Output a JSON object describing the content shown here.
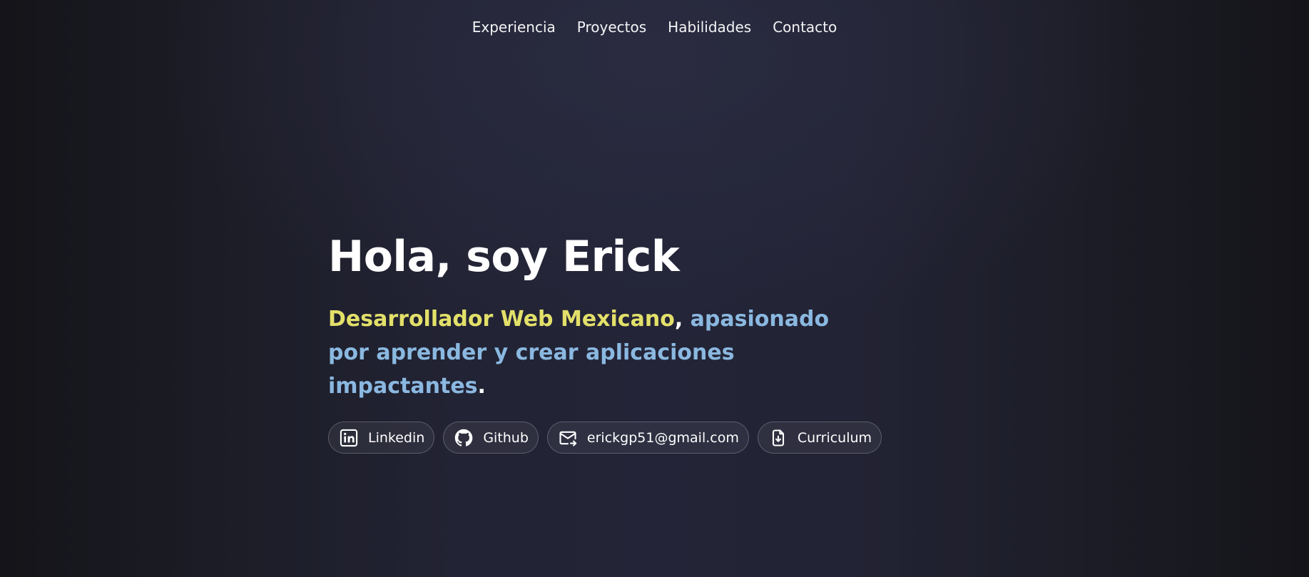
{
  "nav": {
    "items": [
      {
        "label": "Experiencia"
      },
      {
        "label": "Proyectos"
      },
      {
        "label": "Habilidades"
      },
      {
        "label": "Contacto"
      }
    ]
  },
  "hero": {
    "title": "Hola, soy Erick",
    "subtitle": {
      "part1": "Desarrollador Web Mexicano",
      "sep": ", ",
      "part2": "apasionado por aprender y crear aplicaciones impactantes",
      "end": "."
    }
  },
  "links": [
    {
      "label": "Linkedin",
      "icon": "linkedin-icon"
    },
    {
      "label": "Github",
      "icon": "github-icon"
    },
    {
      "label": "erickgp51@gmail.com",
      "icon": "mail-icon"
    },
    {
      "label": "Curriculum",
      "icon": "document-download-icon"
    }
  ],
  "colors": {
    "highlight_yellow": "#e3e06a",
    "highlight_blue": "#8ab8e0",
    "background": "#232437"
  }
}
